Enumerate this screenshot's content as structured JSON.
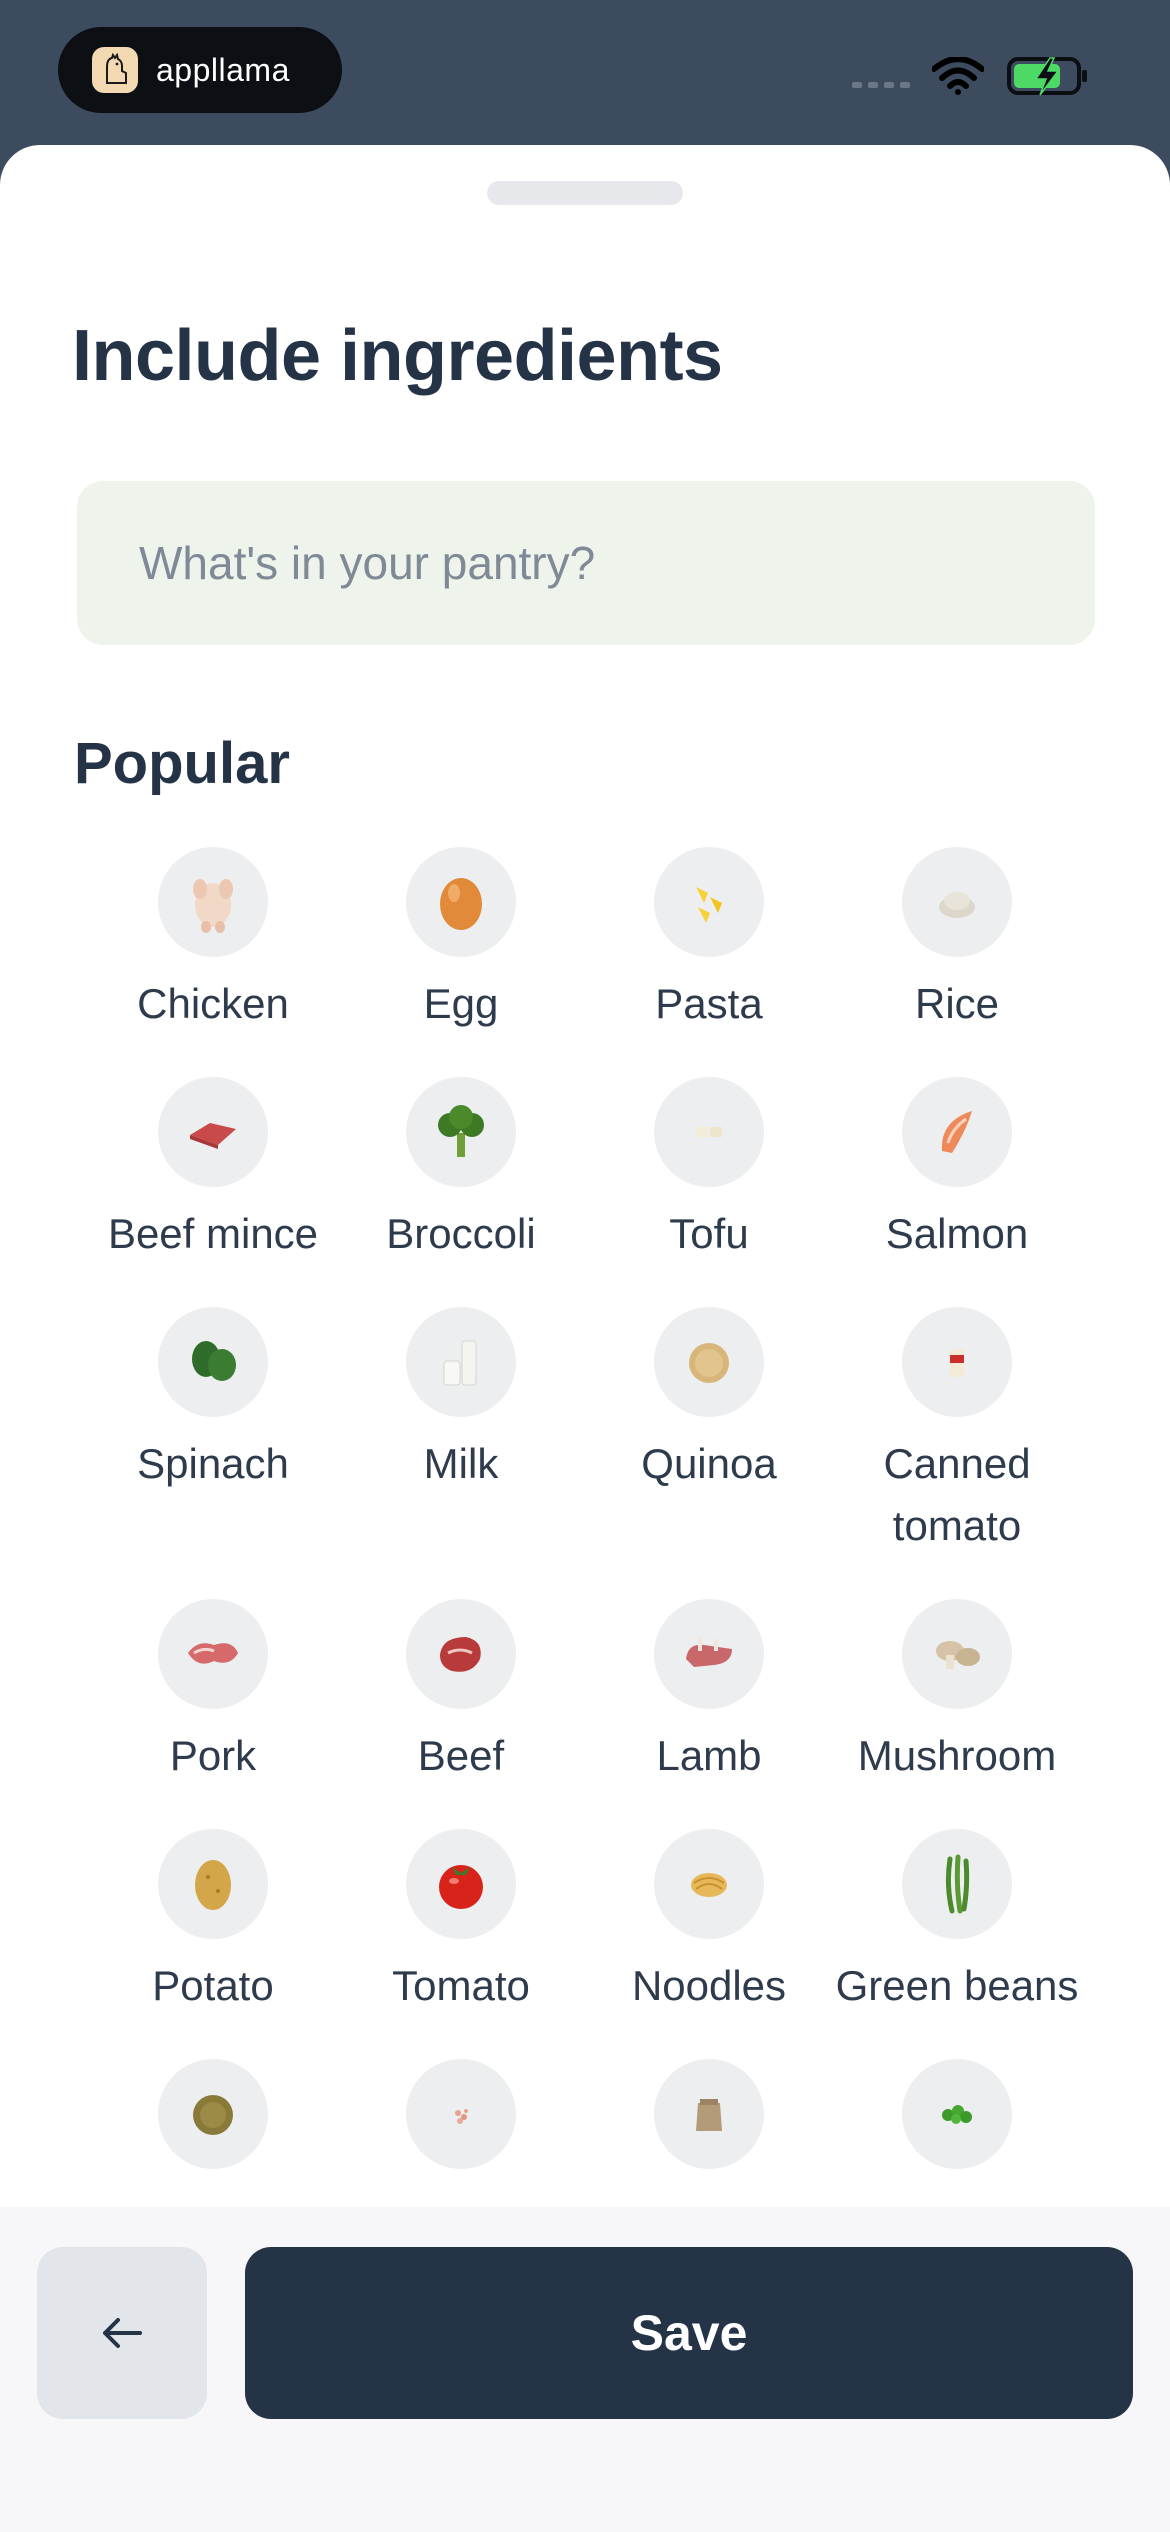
{
  "status_bar": {
    "brand": "appllama",
    "colors": {
      "battery": "#4cd964"
    }
  },
  "sheet": {
    "title": "Include ingredients",
    "search": {
      "placeholder": "What's in your pantry?",
      "value": ""
    },
    "section_title": "Popular",
    "ingredients": [
      {
        "label": "Chicken",
        "icon": "chicken-icon"
      },
      {
        "label": "Egg",
        "icon": "egg-icon"
      },
      {
        "label": "Pasta",
        "icon": "pasta-icon"
      },
      {
        "label": "Rice",
        "icon": "rice-icon"
      },
      {
        "label": "Beef mince",
        "icon": "beef-mince-icon"
      },
      {
        "label": "Broccoli",
        "icon": "broccoli-icon"
      },
      {
        "label": "Tofu",
        "icon": "tofu-icon"
      },
      {
        "label": "Salmon",
        "icon": "salmon-icon"
      },
      {
        "label": "Spinach",
        "icon": "spinach-icon"
      },
      {
        "label": "Milk",
        "icon": "milk-icon"
      },
      {
        "label": "Quinoa",
        "icon": "quinoa-icon"
      },
      {
        "label": "Canned tomato",
        "icon": "canned-tomato-icon"
      },
      {
        "label": "Pork",
        "icon": "pork-icon"
      },
      {
        "label": "Beef",
        "icon": "beef-icon"
      },
      {
        "label": "Lamb",
        "icon": "lamb-icon"
      },
      {
        "label": "Mushroom",
        "icon": "mushroom-icon"
      },
      {
        "label": "Potato",
        "icon": "potato-icon"
      },
      {
        "label": "Tomato",
        "icon": "tomato-icon"
      },
      {
        "label": "Noodles",
        "icon": "noodles-icon"
      },
      {
        "label": "Green beans",
        "icon": "green-beans-icon"
      },
      {
        "label": "",
        "icon": "lentils-icon"
      },
      {
        "label": "",
        "icon": "salt-icon"
      },
      {
        "label": "",
        "icon": "flour-icon"
      },
      {
        "label": "",
        "icon": "peas-icon"
      }
    ]
  },
  "actions": {
    "back_icon": "arrow-left-icon",
    "save_label": "Save"
  }
}
